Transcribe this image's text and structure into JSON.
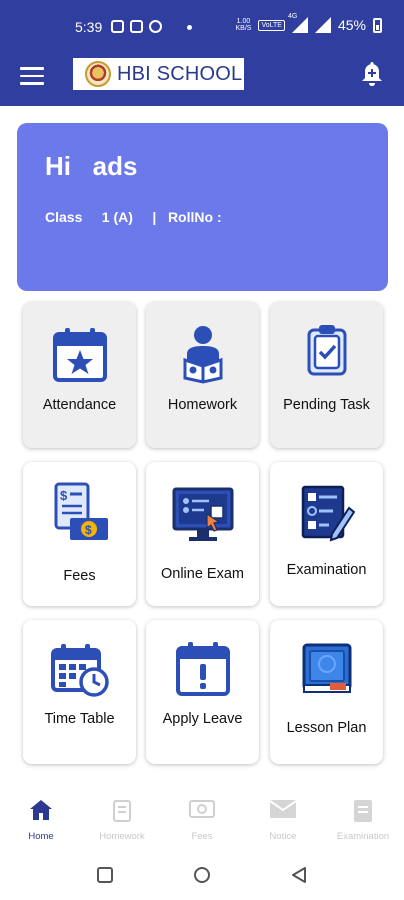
{
  "status_bar": {
    "time": "5:39",
    "data_rate_top": "1.00",
    "data_rate_bottom": "KB/S",
    "volte": "VoLTE",
    "network": "4G",
    "battery": "45%"
  },
  "app_bar": {
    "menu_icon": "hamburger-icon",
    "logo_text": "HBI SCHOOL",
    "bell_icon": "bell-icon"
  },
  "greeting": {
    "hi": "Hi   ads",
    "class_line": "Class     1 (A)     |   RollNo :"
  },
  "tiles": [
    {
      "label": "Attendance",
      "icon": "calendar-star-icon"
    },
    {
      "label": "Homework",
      "icon": "student-reading-icon"
    },
    {
      "label": "Pending Task",
      "icon": "clipboard-check-icon"
    },
    {
      "label": "Fees",
      "icon": "bill-coin-icon"
    },
    {
      "label": "Online Exam",
      "icon": "monitor-exam-icon"
    },
    {
      "label": "Examination",
      "icon": "exam-sheet-pen-icon"
    },
    {
      "label": "Time Table",
      "icon": "calendar-clock-icon"
    },
    {
      "label": "Apply Leave",
      "icon": "calendar-alert-icon"
    },
    {
      "label": "Lesson Plan",
      "icon": "book-icon"
    }
  ],
  "bottom_nav": [
    {
      "label": "Home",
      "icon": "home-icon",
      "active": true
    },
    {
      "label": "Homework",
      "icon": "homework-icon",
      "active": false
    },
    {
      "label": "Fees",
      "icon": "banknote-icon",
      "active": false
    },
    {
      "label": "Notice",
      "icon": "envelope-icon",
      "active": false
    },
    {
      "label": "Examination",
      "icon": "exam-icon",
      "active": false
    }
  ],
  "colors": {
    "primary": "#303F9F",
    "card": "#6C79EB",
    "icon_blue": "#2b4fb7",
    "active_nav": "#2b3990"
  }
}
